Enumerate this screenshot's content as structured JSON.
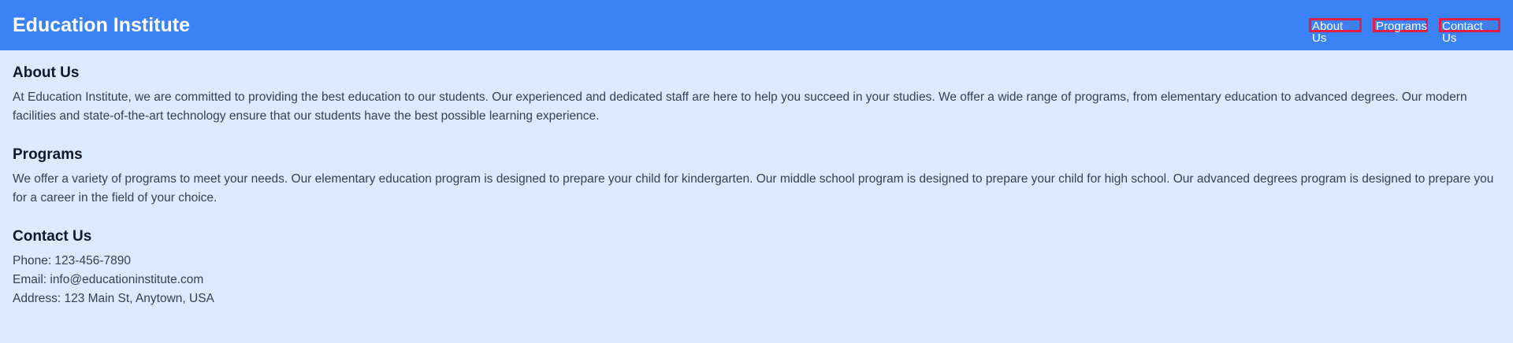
{
  "header": {
    "brand": "Education Institute",
    "nav": [
      {
        "label": "About Us"
      },
      {
        "label": "Programs"
      },
      {
        "label": "Contact Us"
      }
    ]
  },
  "about": {
    "heading": "About Us",
    "text": "At Education Institute, we are committed to providing the best education to our students. Our experienced and dedicated staff are here to help you succeed in your studies. We offer a wide range of programs, from elementary education to advanced degrees. Our modern facilities and state-of-the-art technology ensure that our students have the best possible learning experience."
  },
  "programs": {
    "heading": "Programs",
    "text": "We offer a variety of programs to meet your needs. Our elementary education program is designed to prepare your child for kindergarten. Our middle school program is designed to prepare your child for high school. Our advanced degrees program is designed to prepare you for a career in the field of your choice."
  },
  "contact": {
    "heading": "Contact Us",
    "phone": "Phone: 123-456-7890",
    "email": "Email: info@educationinstitute.com",
    "address": "Address: 123 Main St, Anytown, USA"
  },
  "colors": {
    "header_bg": "#3b82f6",
    "page_bg": "#dbeafe",
    "nav_outline": "#e11d48"
  }
}
